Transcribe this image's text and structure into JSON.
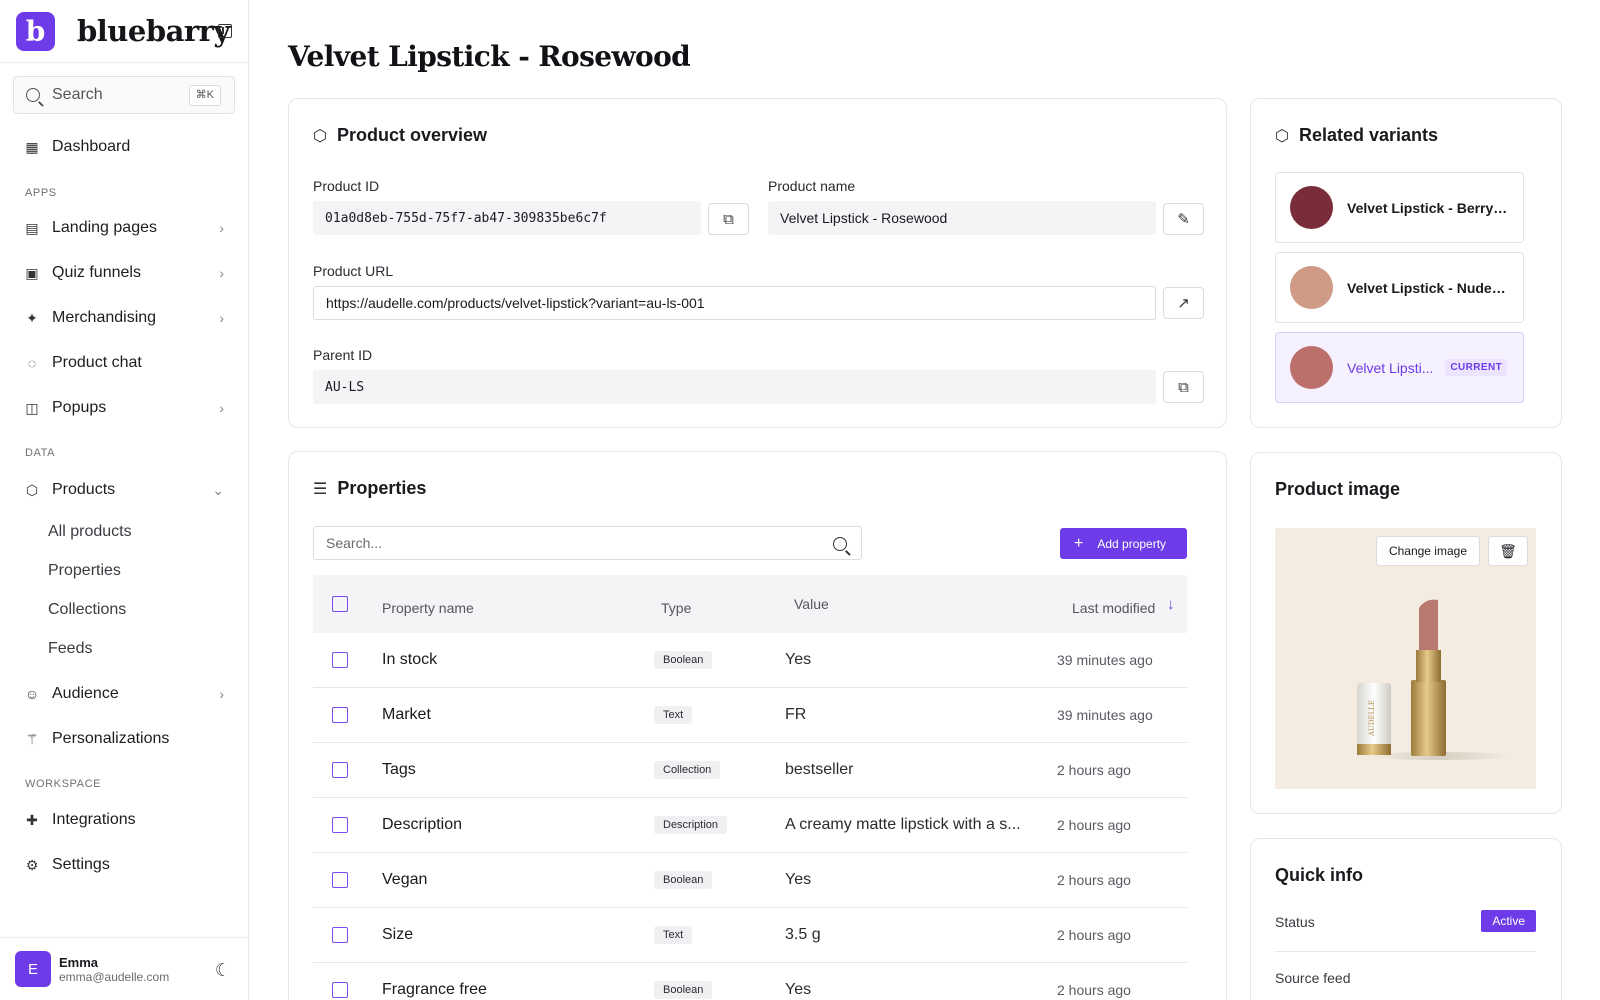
{
  "brand": {
    "logo_letter": "b",
    "name": "bluebarry"
  },
  "sidebar": {
    "search_label": "Search",
    "search_shortcut": "⌘K",
    "dashboard": "Dashboard",
    "apps_label": "APPS",
    "apps": [
      "Landing pages",
      "Quiz funnels",
      "Merchandising",
      "Product chat",
      "Popups"
    ],
    "data_label": "DATA",
    "products": "Products",
    "product_sub": [
      "All products",
      "Properties",
      "Collections",
      "Feeds"
    ],
    "audience": "Audience",
    "personalizations": "Personalizations",
    "workspace_label": "WORKSPACE",
    "integrations": "Integrations",
    "settings": "Settings",
    "user": {
      "initial": "E",
      "name": "Emma",
      "email": "emma@audelle.com"
    }
  },
  "page": {
    "title": "Velvet Lipstick - Rosewood"
  },
  "overview": {
    "title": "Product overview",
    "product_id_label": "Product ID",
    "product_id": "01a0d8eb-755d-75f7-ab47-309835be6c7f",
    "product_name_label": "Product name",
    "product_name": "Velvet Lipstick - Rosewood",
    "product_url_label": "Product URL",
    "product_url": "https://audelle.com/products/velvet-lipstick?variant=au-ls-001",
    "parent_id_label": "Parent ID",
    "parent_id": "AU-LS"
  },
  "variants": {
    "title": "Related variants",
    "items": [
      {
        "name": "Velvet Lipstick - Berry N...",
        "color": "#7a2c3a"
      },
      {
        "name": "Velvet Lipstick - Nude Silk",
        "color": "#cf9a86"
      },
      {
        "name": "Velvet Lipsti...",
        "color": "#bd6f6b",
        "badge": "CURRENT"
      }
    ]
  },
  "properties": {
    "title": "Properties",
    "search_placeholder": "Search...",
    "add_label": "Add property",
    "columns": [
      "Property name",
      "Type",
      "Value",
      "Last modified"
    ],
    "rows": [
      {
        "name": "In stock",
        "type": "Boolean",
        "value": "Yes",
        "modified": "39 minutes ago"
      },
      {
        "name": "Market",
        "type": "Text",
        "value": "FR",
        "modified": "39 minutes ago"
      },
      {
        "name": "Tags",
        "type": "Collection",
        "value": "bestseller",
        "modified": "2 hours ago"
      },
      {
        "name": "Description",
        "type": "Description",
        "value": "A creamy matte lipstick with a s...",
        "modified": "2 hours ago"
      },
      {
        "name": "Vegan",
        "type": "Boolean",
        "value": "Yes",
        "modified": "2 hours ago"
      },
      {
        "name": "Size",
        "type": "Text",
        "value": "3.5 g",
        "modified": "2 hours ago"
      },
      {
        "name": "Fragrance free",
        "type": "Boolean",
        "value": "Yes",
        "modified": "2 hours ago"
      }
    ]
  },
  "image": {
    "title": "Product image",
    "change_label": "Change image",
    "lipstick_brand": "AUDELLE"
  },
  "quick_info": {
    "title": "Quick info",
    "status_label": "Status",
    "status_value": "Active",
    "source_feed_label": "Source feed"
  },
  "colors": {
    "accent": "#6d3ce8"
  }
}
